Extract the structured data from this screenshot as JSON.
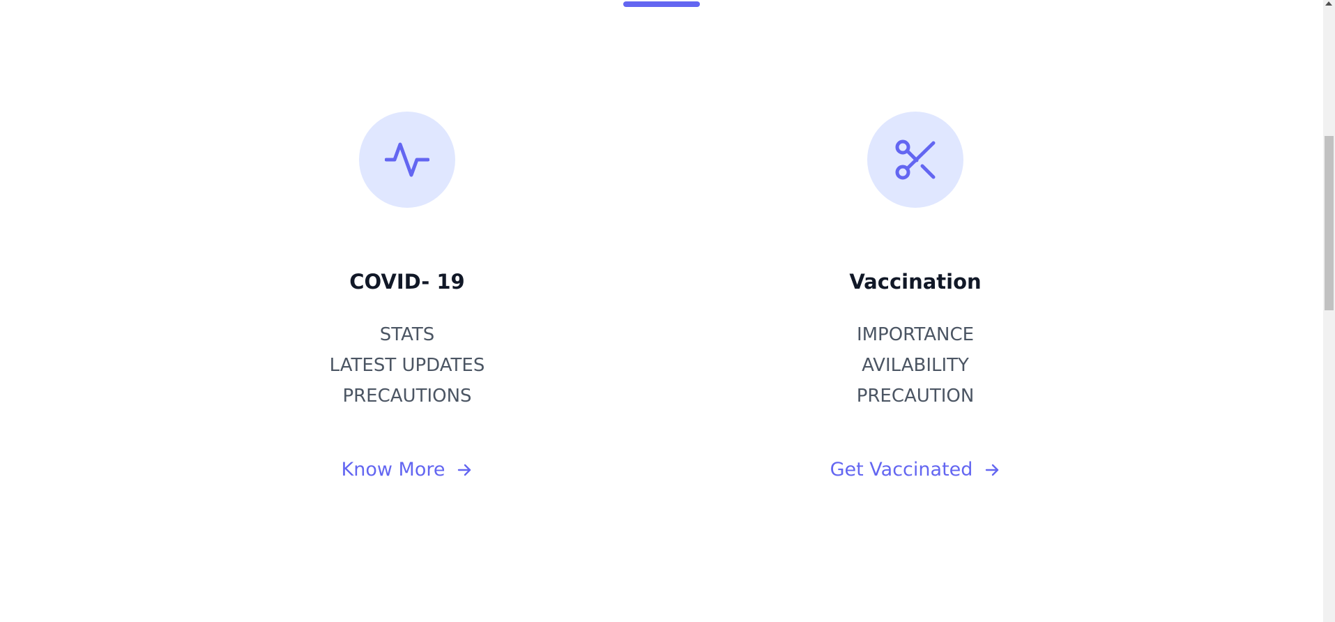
{
  "colors": {
    "accent": "#6366f1",
    "icon_bg": "#e0e7ff",
    "title": "#111827",
    "body_text": "#4b5563"
  },
  "cards": [
    {
      "icon": "pulse-icon",
      "title": "COVID- 19",
      "items": [
        "STATS",
        "LATEST UPDATES",
        "PRECAUTIONS"
      ],
      "link_label": "Know More"
    },
    {
      "icon": "scissors-icon",
      "title": "Vaccination",
      "items": [
        "IMPORTANCE",
        "AVILABILITY",
        "PRECAUTION"
      ],
      "link_label": "Get Vaccinated"
    }
  ]
}
